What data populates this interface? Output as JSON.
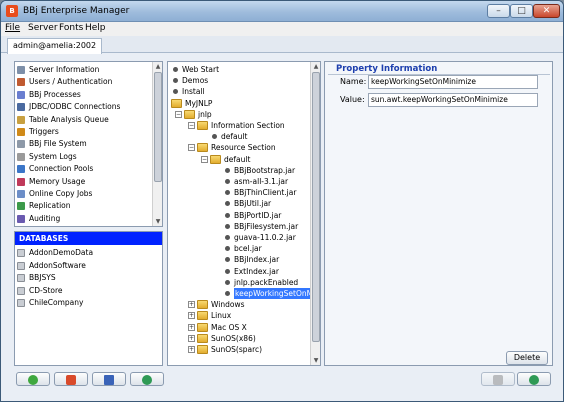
{
  "window": {
    "title": "BBj Enterprise Manager"
  },
  "menu": {
    "file": "File",
    "server": "Server",
    "fonts": "Fonts",
    "help": "Help"
  },
  "tab": {
    "label": "admin@amelia:2002"
  },
  "server_items": [
    {
      "label": "Server Information",
      "icon": "server-info-icon",
      "color": "#7d8fa8"
    },
    {
      "label": "Users / Authentication",
      "icon": "users-icon",
      "color": "#c05a30"
    },
    {
      "label": "BBj Processes",
      "icon": "processes-icon",
      "color": "#6a7ed0"
    },
    {
      "label": "JDBC/ODBC Connections",
      "icon": "connections-icon",
      "color": "#4a6aa0"
    },
    {
      "label": "Table Analysis Queue",
      "icon": "queue-icon",
      "color": "#c8a040"
    },
    {
      "label": "Triggers",
      "icon": "trigger-icon",
      "color": "#d08a18"
    },
    {
      "label": "BBj File System",
      "icon": "filesystem-icon",
      "color": "#8d99a8"
    },
    {
      "label": "System Logs",
      "icon": "logs-icon",
      "color": "#9a9a9a"
    },
    {
      "label": "Connection Pools",
      "icon": "pools-icon",
      "color": "#3b76c8"
    },
    {
      "label": "Memory Usage",
      "icon": "memory-icon",
      "color": "#c0395a"
    },
    {
      "label": "Online Copy Jobs",
      "icon": "copy-jobs-icon",
      "color": "#6c8ec8"
    },
    {
      "label": "Replication",
      "icon": "replication-icon",
      "color": "#3c9a4a"
    },
    {
      "label": "Auditing",
      "icon": "auditing-icon",
      "color": "#6a5ab0"
    }
  ],
  "databases": {
    "header": "DATABASES",
    "items": [
      "AddonDemoData",
      "AddonSoftware",
      "BBJSYS",
      "CD-Store",
      "ChileCompany"
    ]
  },
  "tree": [
    {
      "label": "Web Start",
      "type": "bullet",
      "depth": 0
    },
    {
      "label": "Demos",
      "type": "bullet",
      "depth": 0
    },
    {
      "label": "Install",
      "type": "bullet",
      "depth": 0
    },
    {
      "label": "MyJNLP",
      "type": "folder",
      "depth": 0
    },
    {
      "label": "jnlp",
      "type": "folder",
      "depth": 1,
      "expander": "−"
    },
    {
      "label": "Information Section",
      "type": "folder",
      "depth": 2,
      "expander": "−"
    },
    {
      "label": "default",
      "type": "bullet",
      "depth": 3
    },
    {
      "label": "Resource Section",
      "type": "folder",
      "depth": 2,
      "expander": "−"
    },
    {
      "label": "default",
      "type": "folder",
      "depth": 3,
      "expander": "−"
    },
    {
      "label": "BBjBootstrap.jar",
      "type": "bullet",
      "depth": 4
    },
    {
      "label": "asm-all-3.1.jar",
      "type": "bullet",
      "depth": 4
    },
    {
      "label": "BBjThinClient.jar",
      "type": "bullet",
      "depth": 4
    },
    {
      "label": "BBjUtil.jar",
      "type": "bullet",
      "depth": 4
    },
    {
      "label": "BBjPortID.jar",
      "type": "bullet",
      "depth": 4
    },
    {
      "label": "BBjFilesystem.jar",
      "type": "bullet",
      "depth": 4
    },
    {
      "label": "guava-11.0.2.jar",
      "type": "bullet",
      "depth": 4
    },
    {
      "label": "bcel.jar",
      "type": "bullet",
      "depth": 4
    },
    {
      "label": "BBjIndex.jar",
      "type": "bullet",
      "depth": 4
    },
    {
      "label": "ExtIndex.jar",
      "type": "bullet",
      "depth": 4
    },
    {
      "label": "jnlp.packEnabled",
      "type": "bullet",
      "depth": 4
    },
    {
      "label": "keepWorkingSetOnMi",
      "type": "bullet",
      "depth": 4,
      "selected": true
    },
    {
      "label": "Windows",
      "type": "folder",
      "depth": 2,
      "expander": "+"
    },
    {
      "label": "Linux",
      "type": "folder",
      "depth": 2,
      "expander": "+"
    },
    {
      "label": "Mac OS X",
      "type": "folder",
      "depth": 2,
      "expander": "+"
    },
    {
      "label": "SunOS(x86)",
      "type": "folder",
      "depth": 2,
      "expander": "+"
    },
    {
      "label": "SunOS(sparc)",
      "type": "folder",
      "depth": 2,
      "expander": "+"
    }
  ],
  "property": {
    "title": "Property Information",
    "name_label": "Name:",
    "name_value": "keepWorkingSetOnMinimize",
    "value_label": "Value:",
    "value_value": "sun.awt.keepWorkingSetOnMinimize",
    "delete_label": "Delete"
  },
  "toolbar": {
    "add_icon": "add-icon",
    "connect_icon": "anchor-icon",
    "delete_icon": "trash-icon",
    "refresh_icon": "refresh-icon",
    "disabled_icon": "disabled-icon"
  }
}
